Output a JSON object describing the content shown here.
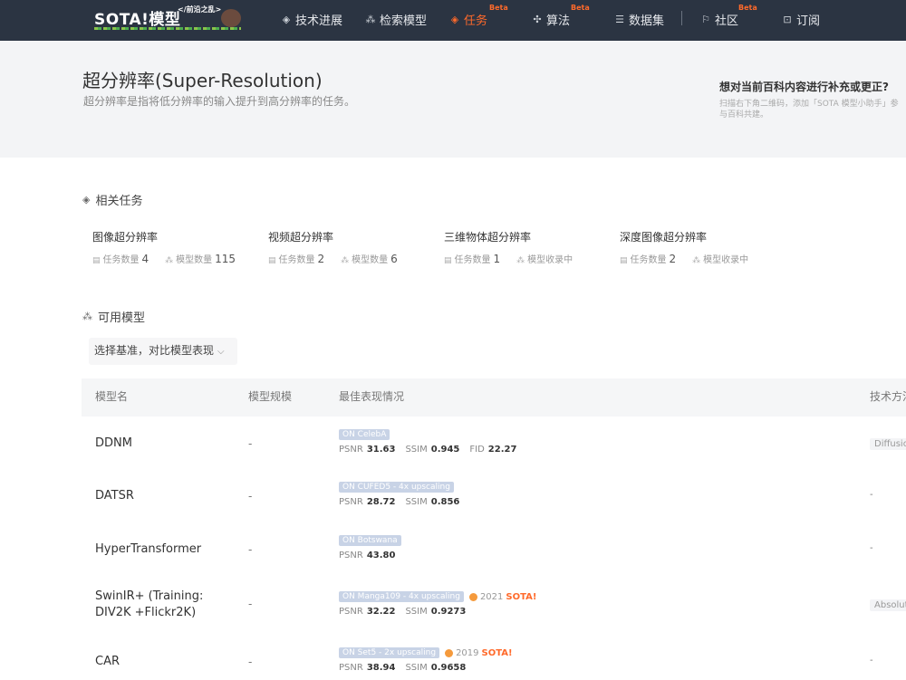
{
  "nav": {
    "logo_text": "SOTA!模型",
    "logo_tag": "</前沿之乱>",
    "items": [
      {
        "label": "技术进展",
        "icon": "layers-icon",
        "beta": ""
      },
      {
        "label": "检索模型",
        "icon": "cluster-icon",
        "beta": ""
      },
      {
        "label": "任务",
        "icon": "task-icon",
        "beta": "Beta"
      },
      {
        "label": "算法",
        "icon": "algorithm-icon",
        "beta": "Beta"
      },
      {
        "label": "数据集",
        "icon": "database-icon",
        "beta": ""
      },
      {
        "label": "社区",
        "icon": "flag-icon",
        "beta": "Beta"
      },
      {
        "label": "订阅",
        "icon": "bookmark-icon",
        "beta": ""
      }
    ],
    "active_color": "#ff6a2b"
  },
  "hero": {
    "title": "超分辨率(Super-Resolution)",
    "subtitle": "超分辨率是指将低分辨率的输入提升到高分辨率的任务。",
    "feedback_title": "想对当前百科内容进行补充或更正?",
    "feedback_text": "扫描右下角二维码，添加「SOTA 模型小助手」参与百科共建。"
  },
  "related": {
    "heading": "相关任务",
    "task_count_label": "任务数量",
    "model_count_label": "模型数量",
    "items": [
      {
        "name": "图像超分辨率",
        "tasks": "4",
        "models_label": "模型数量",
        "models": "115"
      },
      {
        "name": "视频超分辨率",
        "tasks": "2",
        "models_label": "模型数量",
        "models": "6"
      },
      {
        "name": "三维物体超分辨率",
        "tasks": "1",
        "models_label": "模型收录中",
        "models": ""
      },
      {
        "name": "深度图像超分辨率",
        "tasks": "2",
        "models_label": "模型收录中",
        "models": ""
      }
    ]
  },
  "models": {
    "heading": "可用模型",
    "select_label": "选择基准，对比模型表现",
    "columns": [
      "模型名",
      "模型规模",
      "最佳表现情况",
      "技术方法"
    ],
    "rows": [
      {
        "name": "DDNM",
        "size": "-",
        "dataset": "ON CelebA",
        "sota_year": "",
        "sota_word": "",
        "metrics": [
          {
            "k": "PSNR",
            "v": "31.63"
          },
          {
            "k": "SSIM",
            "v": "0.945"
          },
          {
            "k": "FID",
            "v": "22.27"
          }
        ],
        "method": "Diffusion"
      },
      {
        "name": "DATSR",
        "size": "-",
        "dataset": "ON CUFED5 - 4x upscaling",
        "sota_year": "",
        "sota_word": "",
        "metrics": [
          {
            "k": "PSNR",
            "v": "28.72"
          },
          {
            "k": "SSIM",
            "v": "0.856"
          }
        ],
        "method": "-"
      },
      {
        "name": "HyperTransformer",
        "size": "-",
        "dataset": "ON Botswana",
        "sota_year": "",
        "sota_word": "",
        "metrics": [
          {
            "k": "PSNR",
            "v": "43.80"
          }
        ],
        "method": "-"
      },
      {
        "name": "SwinIR+ (Training: DIV2K +Flickr2K)",
        "size": "-",
        "dataset": "ON Manga109 - 4x upscaling",
        "sota_year": "2021",
        "sota_word": "SOTA!",
        "metrics": [
          {
            "k": "PSNR",
            "v": "32.22"
          },
          {
            "k": "SSIM",
            "v": "0.9273"
          }
        ],
        "method": "Absolute"
      },
      {
        "name": "CAR",
        "size": "-",
        "dataset": "ON Set5 - 2x upscaling",
        "sota_year": "2019",
        "sota_word": "SOTA!",
        "metrics": [
          {
            "k": "PSNR",
            "v": "38.94"
          },
          {
            "k": "SSIM",
            "v": "0.9658"
          }
        ],
        "method": "-"
      }
    ]
  }
}
